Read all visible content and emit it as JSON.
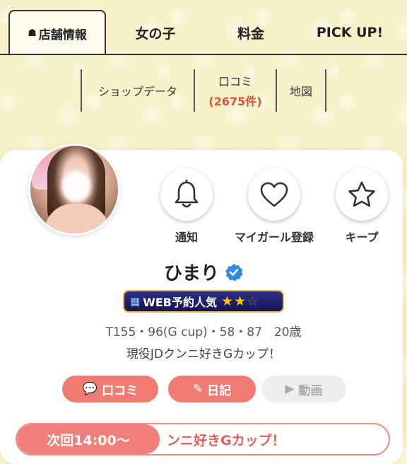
{
  "tabs": {
    "shop_info": "店舗情報",
    "girls": "女の子",
    "price": "料金",
    "pickup": "PICK UP!"
  },
  "subnav": {
    "shop_data": "ショップデータ",
    "review_label": "口コミ",
    "review_count": "(2675件)",
    "map": "地図"
  },
  "profile": {
    "name": "ひまり",
    "web_badge": "WEB予約人気",
    "rating_stars": 2,
    "rating_max": 3,
    "stats": "T155・96(G cup)・58・87　20歳",
    "catchphrase": "現役JDクンニ好きGカップ！"
  },
  "actions": {
    "notify": "通知",
    "my_girl": "マイガール登録",
    "keep": "キープ"
  },
  "buttons": {
    "review": "口コミ",
    "diary": "日記",
    "video": "動画"
  },
  "next": {
    "time": "次回14:00〜",
    "message": "ンニ好きGカップ！"
  },
  "colors": {
    "accent": "#f07b72",
    "review_count": "#d9533f",
    "badge_bg": "#1f1f6e",
    "verified": "#2a8be8"
  }
}
